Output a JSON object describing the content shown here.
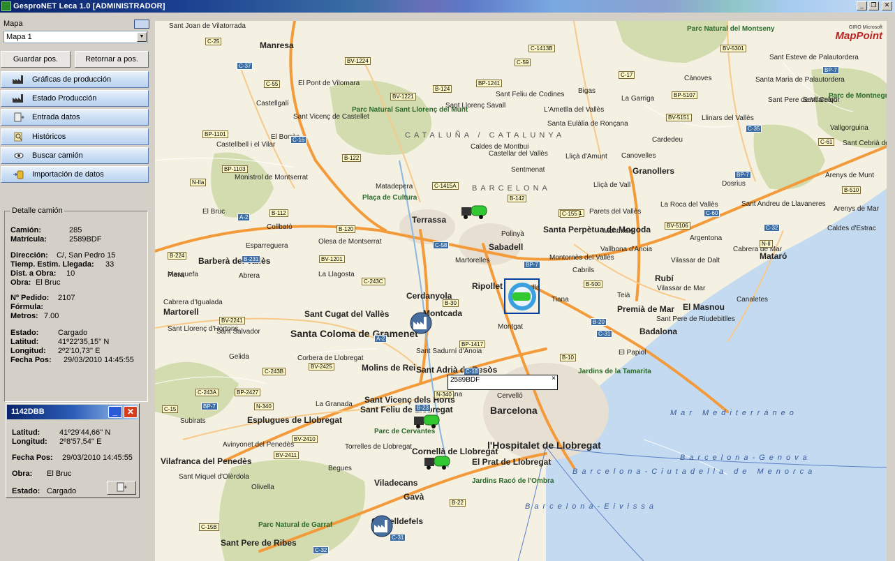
{
  "window": {
    "title": "GesproNET Leca 1.0 [ADMINISTRADOR]"
  },
  "left": {
    "map_label": "Mapa",
    "map_select": "Mapa 1",
    "save_pos": "Guardar pos.",
    "return_pos": "Retornar a pos.",
    "nav": [
      {
        "label": "Gráficas de producción",
        "icon": "factory-icon"
      },
      {
        "label": "Estado Producción",
        "icon": "factory-icon"
      },
      {
        "label": "Entrada datos",
        "icon": "door-icon"
      },
      {
        "label": "Históricos",
        "icon": "magnifier-icon"
      },
      {
        "label": "Buscar camión",
        "icon": "eye-icon"
      },
      {
        "label": "Importación de datos",
        "icon": "import-icon"
      }
    ]
  },
  "detail": {
    "title": "Detalle camión",
    "camion_label": "Camión:",
    "camion": "285",
    "matricula_label": "Matrícula:",
    "matricula": "2589BDF",
    "direccion_label": "Dirección:",
    "direccion": "C/, San Pedro 15",
    "tiempo_label": "Tiemp. Estim. Llegada:",
    "tiempo": "33",
    "dist_label": "Dist. a Obra:",
    "dist": "10",
    "obra_label": "Obra:",
    "obra": "El Bruc",
    "pedido_label": "Nº Pedido:",
    "pedido": "2107",
    "formula_label": "Fórmula:",
    "formula": "",
    "metros_label": "Metros:",
    "metros": "7.00",
    "estado_label": "Estado:",
    "estado": "Cargado",
    "latitud_label": "Latitud:",
    "latitud": "41º22'35,15'' N",
    "longitud_label": "Longitud:",
    "longitud": "2º2'10,73'' E",
    "fecha_label": "Fecha Pos:",
    "fecha": "29/03/2010 14:45:55"
  },
  "truck_window": {
    "title": "1142DBB",
    "latitud_label": "Latitud:",
    "latitud": "41º29'44,66'' N",
    "longitud_label": "Longitud:",
    "longitud": "2º8'57,54'' E",
    "fecha_label": "Fecha Pos:",
    "fecha": "29/03/2010 14:45:55",
    "obra_label": "Obra:",
    "obra": "El Bruc",
    "estado_label": "Estado:",
    "estado": "Cargado"
  },
  "map": {
    "logo_small": "GIRO Microsoft",
    "logo": "MapPoint",
    "callout_id": "2589BDF",
    "callout_close": "×",
    "labels": [
      {
        "t": "Sant Joan de Vilatorrada",
        "c": "lbl"
      },
      {
        "t": "Manresa",
        "c": "lbl big"
      },
      {
        "t": "El Pont de Vilomara",
        "c": "lbl"
      },
      {
        "t": "Castellgalí",
        "c": "lbl"
      },
      {
        "t": "Sant Vicenç de Castellet",
        "c": "lbl"
      },
      {
        "t": "Parc Natural Sant Llorenç del Munt",
        "c": "lbl park"
      },
      {
        "t": "Sant Llorenç Savall",
        "c": "lbl"
      },
      {
        "t": "Sant Feliu de Codines",
        "c": "lbl"
      },
      {
        "t": "Bigas",
        "c": "lbl"
      },
      {
        "t": "L'Ametlla del Vallès",
        "c": "lbl"
      },
      {
        "t": "Santa Eulàlia de Ronçana",
        "c": "lbl"
      },
      {
        "t": "La Garriga",
        "c": "lbl"
      },
      {
        "t": "Parc Natural del Montseny",
        "c": "lbl park"
      },
      {
        "t": "Sant Esteve de Palautordera",
        "c": "lbl"
      },
      {
        "t": "Santa Maria de Palautordera",
        "c": "lbl"
      },
      {
        "t": "Cànoves",
        "c": "lbl"
      },
      {
        "t": "Sant Pere de Vilamajor",
        "c": "lbl"
      },
      {
        "t": "Sant Celoni",
        "c": "lbl"
      },
      {
        "t": "Parc de Montnegre Corredor",
        "c": "lbl park"
      },
      {
        "t": "CATALUÑA / CATALUNYA",
        "c": "lbl region"
      },
      {
        "t": "El Borràs",
        "c": "lbl"
      },
      {
        "t": "Castellbell i el Vilar",
        "c": "lbl"
      },
      {
        "t": "Caldes de Montbui",
        "c": "lbl"
      },
      {
        "t": "Castellar del Vallès",
        "c": "lbl"
      },
      {
        "t": "Sentmenat",
        "c": "lbl"
      },
      {
        "t": "Lliçà d'Amunt",
        "c": "lbl"
      },
      {
        "t": "Granollers",
        "c": "lbl big"
      },
      {
        "t": "Cardedeu",
        "c": "lbl"
      },
      {
        "t": "Llinars del Vallès",
        "c": "lbl"
      },
      {
        "t": "Vallgorguina",
        "c": "lbl"
      },
      {
        "t": "Sant Cebrià de Vallalta",
        "c": "lbl"
      },
      {
        "t": "Monistrol de Montserrat",
        "c": "lbl"
      },
      {
        "t": "Matadepera",
        "c": "lbl"
      },
      {
        "t": "BARCELONA",
        "c": "lbl region"
      },
      {
        "t": "Lliçà de Vall",
        "c": "lbl"
      },
      {
        "t": "Canovelles",
        "c": "lbl"
      },
      {
        "t": "Dosrius",
        "c": "lbl"
      },
      {
        "t": "Arenys de Munt",
        "c": "lbl"
      },
      {
        "t": "Plaça de Cultura",
        "c": "lbl park"
      },
      {
        "t": "Terrassa",
        "c": "lbl big"
      },
      {
        "t": "Parets del Vallès",
        "c": "lbl"
      },
      {
        "t": "La Roca del Vallès",
        "c": "lbl"
      },
      {
        "t": "Sant Andreu de Llavaneres",
        "c": "lbl"
      },
      {
        "t": "Arenys de Mar",
        "c": "lbl"
      },
      {
        "t": "El Bruc",
        "c": "lbl"
      },
      {
        "t": "Collbató",
        "c": "lbl"
      },
      {
        "t": "Polinyà",
        "c": "lbl"
      },
      {
        "t": "Santa Perpètua de Mogoda",
        "c": "lbl big"
      },
      {
        "t": "Montmeló",
        "c": "lbl"
      },
      {
        "t": "Caldes d'Estrac",
        "c": "lbl"
      },
      {
        "t": "Esparreguera",
        "c": "lbl"
      },
      {
        "t": "Olesa de Montserrat",
        "c": "lbl"
      },
      {
        "t": "Sabadell",
        "c": "lbl big"
      },
      {
        "t": "Argentona",
        "c": "lbl"
      },
      {
        "t": "Cabrera de Mar",
        "c": "lbl"
      },
      {
        "t": "Mataró",
        "c": "lbl big"
      },
      {
        "t": "Piera",
        "c": "lbl"
      },
      {
        "t": "Barberà del Vallès",
        "c": "lbl big"
      },
      {
        "t": "Martorelles",
        "c": "lbl"
      },
      {
        "t": "Montornès del Vallès",
        "c": "lbl"
      },
      {
        "t": "Vallbona d'Anoia",
        "c": "lbl"
      },
      {
        "t": "Masquefa",
        "c": "lbl"
      },
      {
        "t": "Abrera",
        "c": "lbl"
      },
      {
        "t": "La Llagosta",
        "c": "lbl"
      },
      {
        "t": "Cabrils",
        "c": "lbl"
      },
      {
        "t": "Vilassar de Dalt",
        "c": "lbl"
      },
      {
        "t": "Rubí",
        "c": "lbl big"
      },
      {
        "t": "Cerdanyola",
        "c": "lbl big"
      },
      {
        "t": "Ripollet",
        "c": "lbl big"
      },
      {
        "t": "Alella",
        "c": "lbl"
      },
      {
        "t": "Teià",
        "c": "lbl"
      },
      {
        "t": "Vilassar de Mar",
        "c": "lbl"
      },
      {
        "t": "Canaletes",
        "c": "lbl"
      },
      {
        "t": "Cabrera d'Igualada",
        "c": "lbl"
      },
      {
        "t": "Martorell",
        "c": "lbl big"
      },
      {
        "t": "Sant Cugat del Vallès",
        "c": "lbl big"
      },
      {
        "t": "Montcada",
        "c": "lbl big"
      },
      {
        "t": "Tiana",
        "c": "lbl"
      },
      {
        "t": "Premià de Mar",
        "c": "lbl big"
      },
      {
        "t": "El Masnou",
        "c": "lbl big"
      },
      {
        "t": "Sant Pere de Riudebitlles",
        "c": "lbl"
      },
      {
        "t": "Sant Llorenç d'Hortons",
        "c": "lbl"
      },
      {
        "t": "Sant Salvador",
        "c": "lbl"
      },
      {
        "t": "Santa Coloma de Gramenet",
        "c": "lbl city"
      },
      {
        "t": "Montgat",
        "c": "lbl"
      },
      {
        "t": "Badalona",
        "c": "lbl big"
      },
      {
        "t": "El Papiol",
        "c": "lbl"
      },
      {
        "t": "Sant Sadurní d'Anoia",
        "c": "lbl"
      },
      {
        "t": "Gelida",
        "c": "lbl"
      },
      {
        "t": "Corbera de Llobregat",
        "c": "lbl"
      },
      {
        "t": "Molins de Rei",
        "c": "lbl big"
      },
      {
        "t": "Sant Adrià de Besòs",
        "c": "lbl big"
      },
      {
        "t": "Jardins de la Tamarita",
        "c": "lbl park"
      },
      {
        "t": "Cervelló",
        "c": "lbl"
      },
      {
        "t": "Sant Vicenç dels Horts",
        "c": "lbl big"
      },
      {
        "t": "Sant Feliu de Llobregat",
        "c": "lbl big"
      },
      {
        "t": "Vallirana",
        "c": "lbl"
      },
      {
        "t": "La Granada",
        "c": "lbl"
      },
      {
        "t": "Subirats",
        "c": "lbl"
      },
      {
        "t": "Esplugues de Llobregat",
        "c": "lbl big"
      },
      {
        "t": "Parc de Cervantes",
        "c": "lbl park"
      },
      {
        "t": "Barcelona",
        "c": "lbl city"
      },
      {
        "t": "Mar Mediterráneo",
        "c": "lbl sea"
      },
      {
        "t": "Avinyonet del Penedès",
        "c": "lbl"
      },
      {
        "t": "Torrelles de Llobregat",
        "c": "lbl"
      },
      {
        "t": "Cornellà de Llobregat",
        "c": "lbl big"
      },
      {
        "t": "l'Hospitalet de Llobregat",
        "c": "lbl city"
      },
      {
        "t": "Vilafranca del Penedès",
        "c": "lbl big"
      },
      {
        "t": "Begues",
        "c": "lbl"
      },
      {
        "t": "El Prat de Llobregat",
        "c": "lbl big"
      },
      {
        "t": "Sant Miquel d'Olèrdola",
        "c": "lbl"
      },
      {
        "t": "Viladecans",
        "c": "lbl big"
      },
      {
        "t": "Jardins Racó de l'Ombra",
        "c": "lbl park"
      },
      {
        "t": "Olivella",
        "c": "lbl"
      },
      {
        "t": "Gavà",
        "c": "lbl big"
      },
      {
        "t": "Parc Natural de Garraf",
        "c": "lbl park"
      },
      {
        "t": "Castelldefels",
        "c": "lbl big"
      },
      {
        "t": "Sant Pere de Ribes",
        "c": "lbl big"
      },
      {
        "t": "Barcelona-Genova",
        "c": "lbl sea"
      },
      {
        "t": "Barcelona-Ciutadella de Menorca",
        "c": "lbl sea"
      },
      {
        "t": "Barcelona-Eivissa",
        "c": "lbl sea"
      }
    ],
    "shields": [
      "C-25",
      "BV-1224",
      "C-37",
      "C-55",
      "BV-1221",
      "B-124",
      "BP-1241",
      "C-59",
      "C-1413B",
      "C-17",
      "BV-5301",
      "BP-7",
      "BP-5107",
      "BV-5151",
      "C-35",
      "C-61",
      "BP-1101",
      "C-16",
      "B-122",
      "BP-1103",
      "N-IIa",
      "B-112",
      "A-2",
      "C-1415A",
      "B-142",
      "BP-7",
      "B-510",
      "BV-5031",
      "B-120",
      "C-155",
      "BV-5106",
      "C-60",
      "C-32",
      "N-II",
      "B-224",
      "B-231",
      "BV-1201",
      "C-58",
      "BP-7",
      "B-500",
      "C-243C",
      "B-30",
      "B-20",
      "C-31",
      "BV-2241",
      "A-2",
      "BP-1417",
      "B-10",
      "C-243B",
      "BV-2425",
      "C-18",
      "C-243A",
      "BP-2427",
      "N-340",
      "N-340",
      "B-23",
      "BP-7",
      "C-15",
      "BV-2410",
      "BV-2411",
      "B-22",
      "C-15B",
      "C-31",
      "C-32"
    ]
  }
}
